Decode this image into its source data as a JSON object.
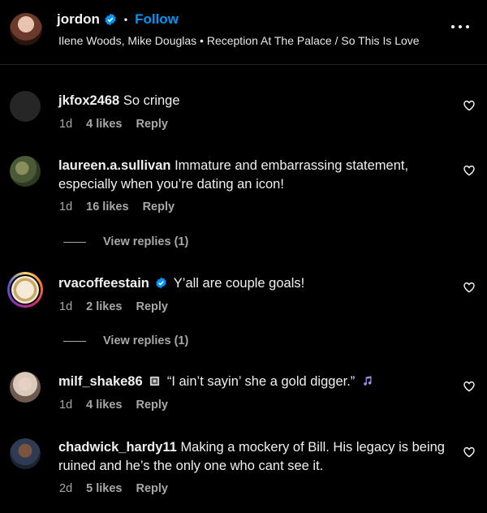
{
  "header": {
    "username": "jordon",
    "follow_label": "Follow",
    "audio": "Ilene Woods, Mike Douglas • Reception At The Palace / So This Is Love"
  },
  "comments": [
    {
      "user": "jkfox2468",
      "text": "So cringe",
      "age": "1d",
      "likes": "4 likes",
      "reply": "Reply"
    },
    {
      "user": "laureen.a.sullivan",
      "text": "Immature and embarrassing statement, especially when you’re dating an icon!",
      "age": "1d",
      "likes": "16 likes",
      "reply": "Reply",
      "view_replies": "View replies (1)"
    },
    {
      "user": "rvacoffeestain",
      "text": "Y’all are couple goals!",
      "age": "1d",
      "likes": "2 likes",
      "reply": "Reply",
      "view_replies": "View replies (1)"
    },
    {
      "user": "milf_shake86",
      "text": "“I ain’t sayin’ she a gold digger.”",
      "age": "1d",
      "likes": "4 likes",
      "reply": "Reply"
    },
    {
      "user": "chadwick_hardy11",
      "text": "Making a mockery of Bill. His legacy is being ruined and he’s the only one who cant see it.",
      "age": "2d",
      "likes": "5 likes",
      "reply": "Reply"
    }
  ],
  "colors": {
    "background": "#000000",
    "accent": "#0095f6",
    "secondary_text": "#a8a8a8"
  },
  "icons": [
    "verified-icon",
    "more-options-icon",
    "heart-icon",
    "tarot-card-icon",
    "music-notes-icon"
  ]
}
